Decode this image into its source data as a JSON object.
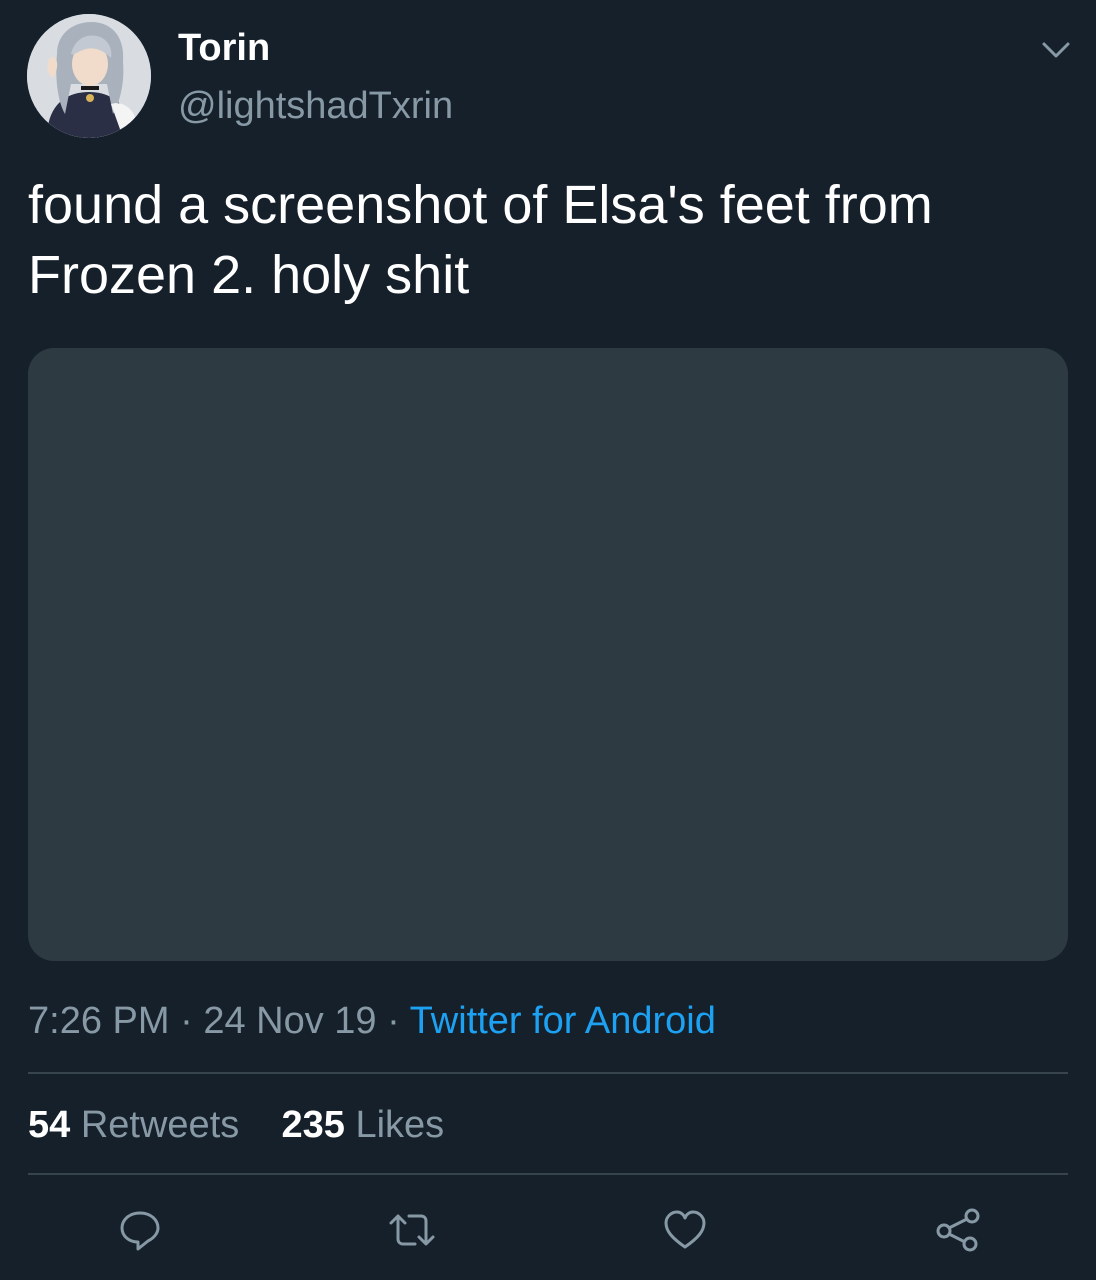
{
  "user": {
    "display_name": "Torin",
    "handle": "@lightshadTxrin"
  },
  "tweet": {
    "text": "found a screenshot of Elsa's feet from Frozen 2. holy shit",
    "time": "7:26 PM",
    "date": "24 Nov 19",
    "separator": "·",
    "source": "Twitter for Android"
  },
  "stats": {
    "retweets_count": "54",
    "retweets_label": "Retweets",
    "likes_count": "235",
    "likes_label": "Likes"
  },
  "icons": {
    "menu": "chevron-down-icon",
    "reply": "reply-icon",
    "retweet": "retweet-icon",
    "like": "heart-icon",
    "share": "share-icon"
  },
  "colors": {
    "background": "#15202b",
    "primary_text": "#ffffff",
    "secondary_text": "#8899a6",
    "accent": "#1da1f2",
    "media_placeholder": "#2e3a42",
    "divider": "#38444d"
  }
}
